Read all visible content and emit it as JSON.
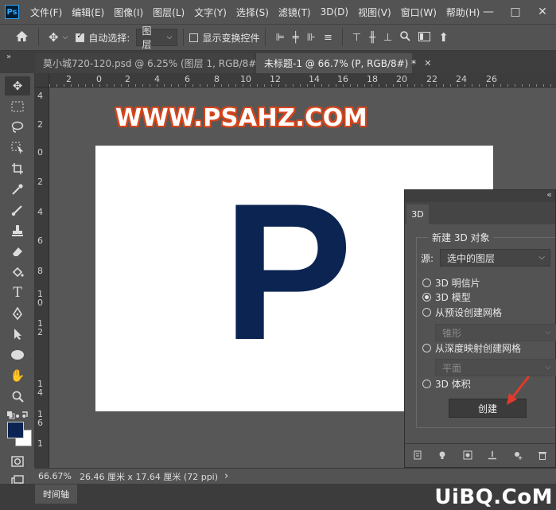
{
  "app": {
    "logo_text": "Ps"
  },
  "menu": [
    "文件(F)",
    "编辑(E)",
    "图像(I)",
    "图层(L)",
    "文字(Y)",
    "选择(S)",
    "滤镜(T)",
    "3D(D)",
    "视图(V)",
    "窗口(W)",
    "帮助(H)"
  ],
  "window_controls": {
    "minimize": "—",
    "maximize": "□",
    "close": "✕"
  },
  "options": {
    "home_icon": "home-icon",
    "move_icon": "move-icon",
    "auto_select_label": "自动选择:",
    "auto_select_checked": true,
    "auto_select_target": "图层",
    "show_transform_label": "显示变换控件",
    "show_transform_checked": false,
    "share_icon": "⬆"
  },
  "tabs": [
    {
      "label": "莫小城720-120.psd @ 6.25% (图层 1, RGB/8#)",
      "close": "✕",
      "active": false
    },
    {
      "label": "未标题-1 @ 66.7% (P, RGB/8#) *",
      "close": "✕",
      "active": true
    }
  ],
  "ruler": {
    "top": [
      "2",
      "0",
      "2",
      "4",
      "6",
      "8",
      "10",
      "12",
      "14",
      "16",
      "18",
      "20",
      "22",
      "24",
      "26"
    ],
    "left": [
      "4",
      "2",
      "0",
      "2",
      "4",
      "6",
      "8",
      "1",
      "0",
      "1",
      "2",
      "1",
      "4",
      "1",
      "6",
      "1"
    ]
  },
  "canvas": {
    "watermark": "WWW.PSAHZ.COM",
    "letter": "P",
    "letter_color": "#0b2452"
  },
  "panel3d": {
    "tab_label": "3D",
    "collapse_icon": "«",
    "group_title": "新建 3D 对象",
    "source_label": "源:",
    "source_value": "选中的图层",
    "options": [
      {
        "label": "3D 明信片",
        "selected": false
      },
      {
        "label": "3D 模型",
        "selected": true
      },
      {
        "label": "从预设创建网格",
        "selected": false
      },
      {
        "label": "从深度映射创建网格",
        "selected": false
      },
      {
        "label": "3D 体积",
        "selected": false
      }
    ],
    "preset_mesh_value": "锥形",
    "depth_map_value": "平面",
    "create_button": "创建"
  },
  "status": {
    "zoom": "66.67%",
    "doc_info": "26.46 厘米 x 17.64 厘米 (72 ppi)",
    "arrow": "›"
  },
  "timeline": {
    "tab_label": "时间轴"
  },
  "site_mark": "UiBQ.CoM",
  "colors": {
    "foreground": "#0b2452",
    "background": "#ffffff",
    "accent_arrow": "#e23a2a",
    "watermark_outline": "#d4451b"
  }
}
